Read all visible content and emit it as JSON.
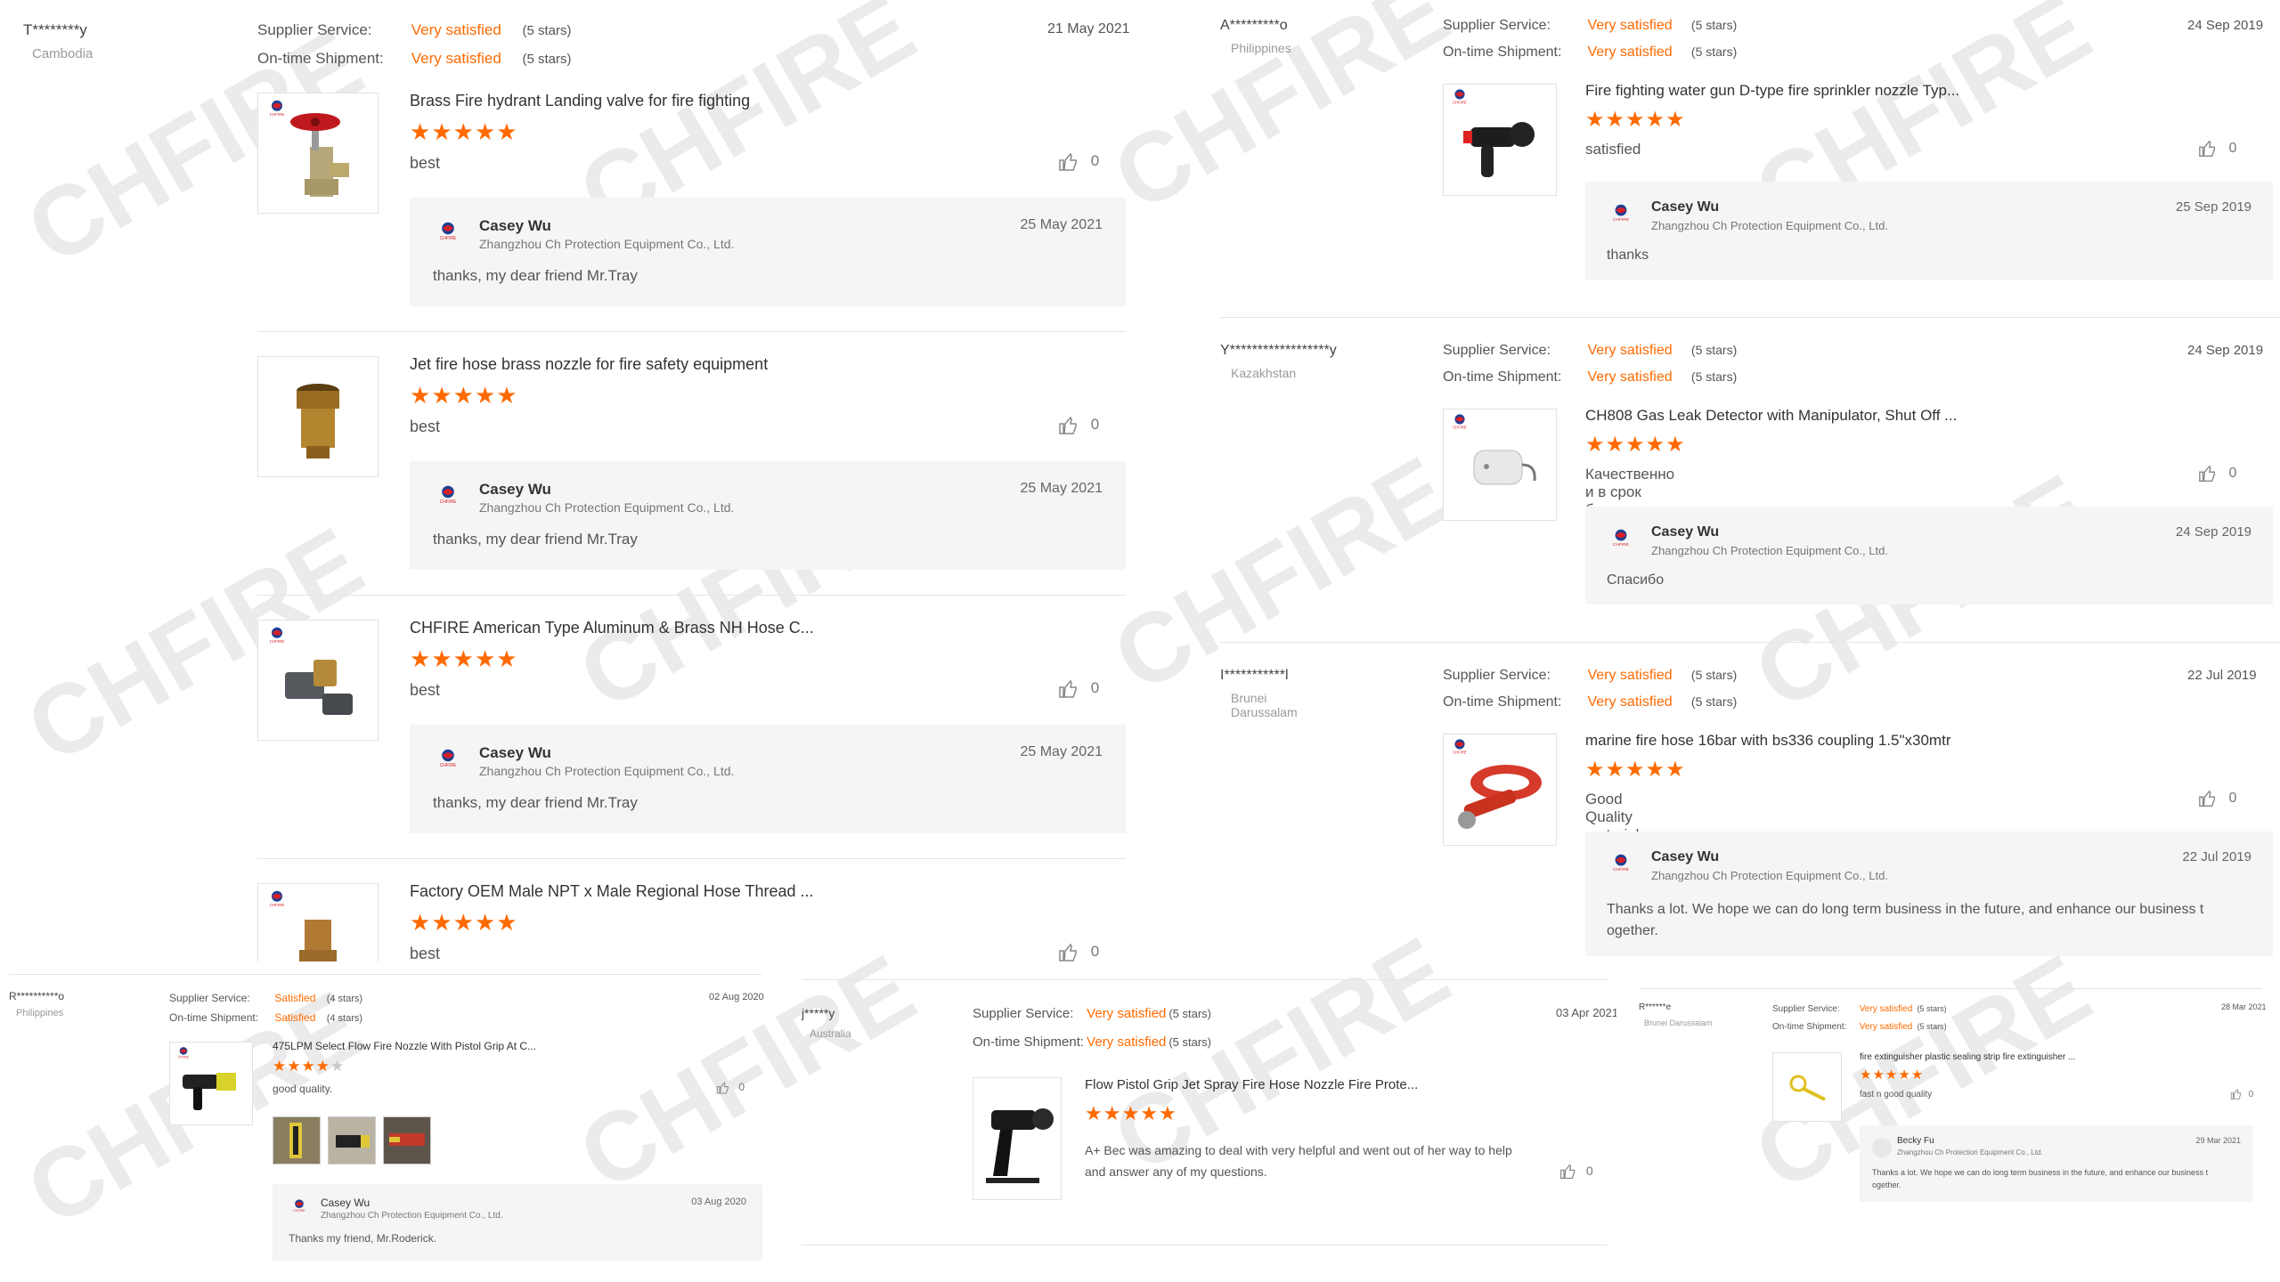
{
  "watermark": "CHFIRE",
  "colors": {
    "accent": "#ff6a00",
    "reply_bg": "#f5f5f5",
    "divider": "#e5e5e5"
  },
  "icons": {
    "like": "thumbs-up-icon",
    "star": "star-icon",
    "logo": "chfire-logo-icon"
  },
  "labels": {
    "supplier_service": "Supplier Service:",
    "on_time": "On-time Shipment:"
  },
  "reply_company": "Zhangzhou Ch Protection Equipment Co., Ltd.",
  "panel_a": {
    "name": "T********y",
    "country": "Cambodia",
    "supplier_value": "Very satisfied",
    "supplier_stars": "(5 stars)",
    "ontime_value": "Very satisfied",
    "ontime_stars": "(5 stars)",
    "date": "21 May 2021",
    "items": [
      {
        "title": "Brass Fire hydrant Landing valve for fire fighting",
        "rating": 5,
        "comment": "best",
        "likes": "0",
        "reply": {
          "name": "Casey Wu",
          "date": "25 May 2021",
          "text": "thanks, my dear friend Mr.Tray"
        }
      },
      {
        "title": "Jet fire hose brass nozzle for fire safety equipment",
        "rating": 5,
        "comment": "best",
        "likes": "0",
        "reply": {
          "name": "Casey Wu",
          "date": "25 May 2021",
          "text": "thanks, my dear friend Mr.Tray"
        }
      },
      {
        "title": "CHFIRE American Type Aluminum & Brass NH Hose C...",
        "rating": 5,
        "comment": "best",
        "likes": "0",
        "reply": {
          "name": "Casey Wu",
          "date": "25 May 2021",
          "text": "thanks, my dear friend Mr.Tray"
        }
      },
      {
        "title": "Factory OEM Male NPT x Male Regional Hose Thread ...",
        "rating": 5,
        "comment": "best",
        "likes": "0"
      }
    ]
  },
  "panel_b": {
    "reviews": [
      {
        "name": "A*********o",
        "country": "Philippines",
        "supplier_value": "Very satisfied",
        "supplier_stars": "(5 stars)",
        "ontime_value": "Very satisfied",
        "ontime_stars": "(5 stars)",
        "date": "24 Sep 2019",
        "title": "Fire fighting water gun D-type fire sprinkler nozzle Typ...",
        "rating": 5,
        "comment": "satisfied",
        "likes": "0",
        "reply": {
          "name": "Casey Wu",
          "date": "25 Sep 2019",
          "text": "thanks"
        }
      },
      {
        "name": "Y******************y",
        "country": "Kazakhstan",
        "supplier_value": "Very satisfied",
        "supplier_stars": "(5 stars)",
        "ontime_value": "Very satisfied",
        "ontime_stars": "(5 stars)",
        "date": "24 Sep 2019",
        "title": "CH808 Gas Leak Detector with Manipulator, Shut Off ...",
        "rating": 5,
        "comment": "Качественно и в срок было доставлено.",
        "likes": "0",
        "reply": {
          "name": "Casey Wu",
          "date": "24 Sep 2019",
          "text": "Спасибо"
        }
      },
      {
        "name": "I***********l",
        "country": "Brunei Darussalam",
        "supplier_value": "Very satisfied",
        "supplier_stars": "(5 stars)",
        "ontime_value": "Very satisfied",
        "ontime_stars": "(5 stars)",
        "date": "22 Jul 2019",
        "title": "marine fire hose 16bar with bs336 coupling 1.5\"x30mtr",
        "rating": 5,
        "comment": "Good Quality material, will order again",
        "likes": "0",
        "reply": {
          "name": "Casey Wu",
          "date": "22 Jul 2019",
          "text": "Thanks a lot. We hope we can do long term business in the future, and enhance our business t ogether."
        }
      }
    ]
  },
  "panel_c": {
    "name": "R**********o",
    "country": "Philippines",
    "supplier_value": "Satisfied",
    "supplier_stars": "(4 stars)",
    "ontime_value": "Satisfied",
    "ontime_stars": "(4 stars)",
    "date": "02 Aug 2020",
    "title": "475LPM Select Flow Fire Nozzle With Pistol Grip At C...",
    "rating": 4,
    "comment": "good quality.",
    "likes": "0",
    "reply": {
      "name": "Casey Wu",
      "date": "03 Aug 2020",
      "text": "Thanks my friend, Mr.Roderick."
    }
  },
  "panel_d": {
    "name": "j*****y",
    "country": "Australia",
    "supplier_value": "Very satisfied",
    "supplier_stars": "(5 stars)",
    "ontime_value": "Very satisfied",
    "ontime_stars": "(5 stars)",
    "date": "03 Apr 2021",
    "title": "Flow Pistol Grip Jet Spray Fire Hose Nozzle Fire Prote...",
    "rating": 5,
    "comment": "A+ Bec was amazing to deal with very helpful and went out of her way to help and answer any of my questions.",
    "likes": "0"
  },
  "panel_e": {
    "name": "R******e",
    "country": "Brunei Darussalam",
    "supplier_value": "Very satisfied",
    "supplier_stars": "(5 stars)",
    "ontime_value": "Very satisfied",
    "ontime_stars": "(5 stars)",
    "date": "28 Mar 2021",
    "title": "fire extinguisher plastic sealing strip fire extinguisher ...",
    "rating": 5,
    "comment": "fast n good quality",
    "likes": "0",
    "reply": {
      "name": "Becky Fu",
      "date": "29 Mar 2021",
      "text": "Thanks a lot. We hope we can do long term business in the future, and enhance our business t ogether."
    }
  }
}
